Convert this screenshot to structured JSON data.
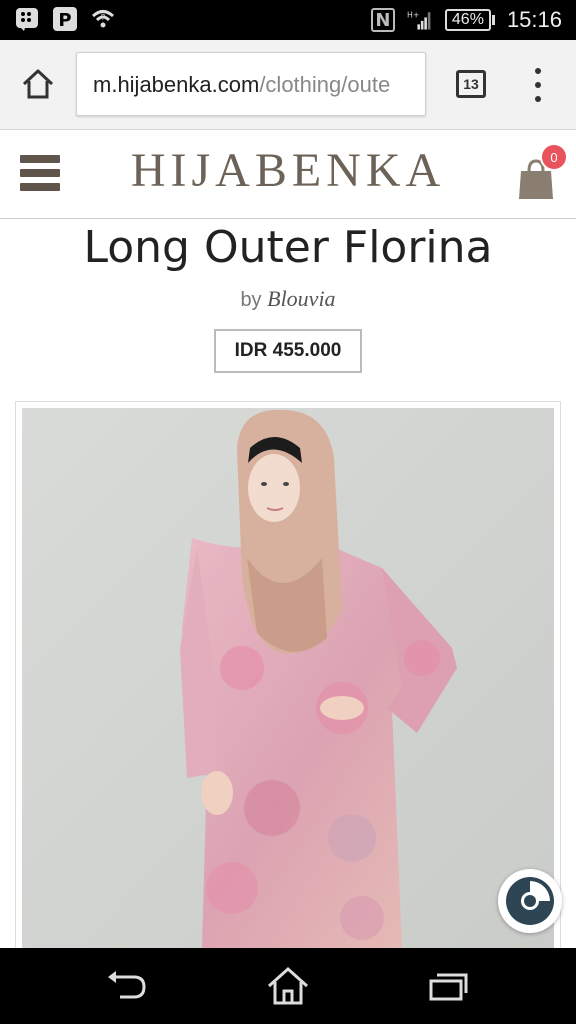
{
  "status_bar": {
    "battery": "46%",
    "time": "15:16",
    "nfc": "N",
    "network": "H+",
    "icons": [
      "bbm-icon",
      "pinterest-icon",
      "wifi-icon",
      "nfc-icon",
      "signal-icon",
      "battery-icon"
    ]
  },
  "browser": {
    "url_host": "m.hijabenka.com",
    "url_path": "/clothing/oute",
    "tab_count": "13"
  },
  "site": {
    "logo": "HIJABENKA",
    "cart_count": "0"
  },
  "product": {
    "title": "Long Outer Florina",
    "by_label": "by",
    "brand": "Blouvia",
    "price": "IDR 455.000"
  },
  "colors": {
    "brand": "#6c6257",
    "badge": "#e8535d",
    "share_accent": "#2e4654"
  }
}
